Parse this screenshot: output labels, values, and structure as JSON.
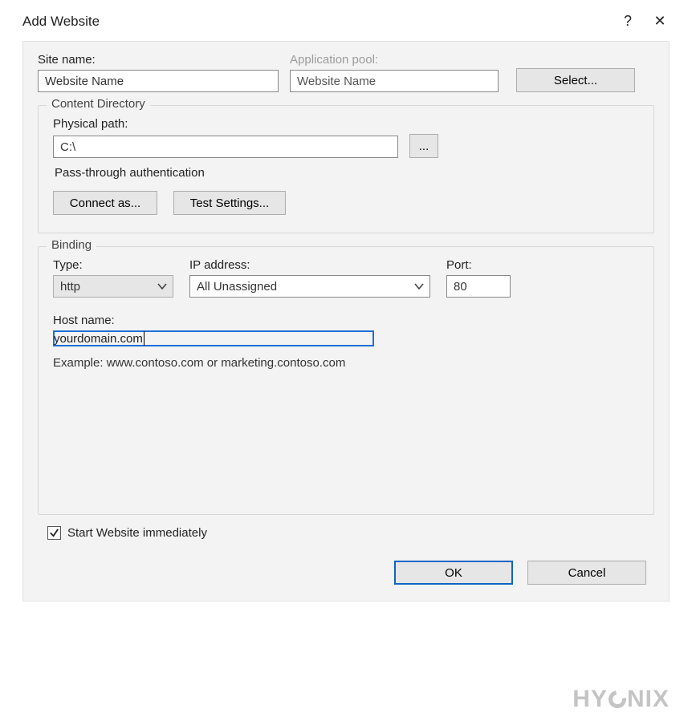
{
  "window": {
    "title": "Add Website",
    "help": "?",
    "close": "✕"
  },
  "site": {
    "name_label": "Site name:",
    "name_value": "Website Name",
    "pool_label": "Application pool:",
    "pool_value": "Website Name",
    "select_button": "Select..."
  },
  "content": {
    "legend": "Content Directory",
    "path_label": "Physical path:",
    "path_value": "C:\\",
    "browse_button": "...",
    "auth_text": "Pass-through authentication",
    "connect_button": "Connect as...",
    "test_button": "Test Settings..."
  },
  "binding": {
    "legend": "Binding",
    "type_label": "Type:",
    "type_value": "http",
    "ip_label": "IP address:",
    "ip_value": "All Unassigned",
    "port_label": "Port:",
    "port_value": "80",
    "host_label": "Host name:",
    "host_value": "yourdomain.com",
    "example": "Example: www.contoso.com or marketing.contoso.com"
  },
  "start": {
    "label": "Start Website immediately",
    "checked": true
  },
  "buttons": {
    "ok": "OK",
    "cancel": "Cancel"
  },
  "watermark": {
    "left": "HY",
    "right": "NIX"
  }
}
